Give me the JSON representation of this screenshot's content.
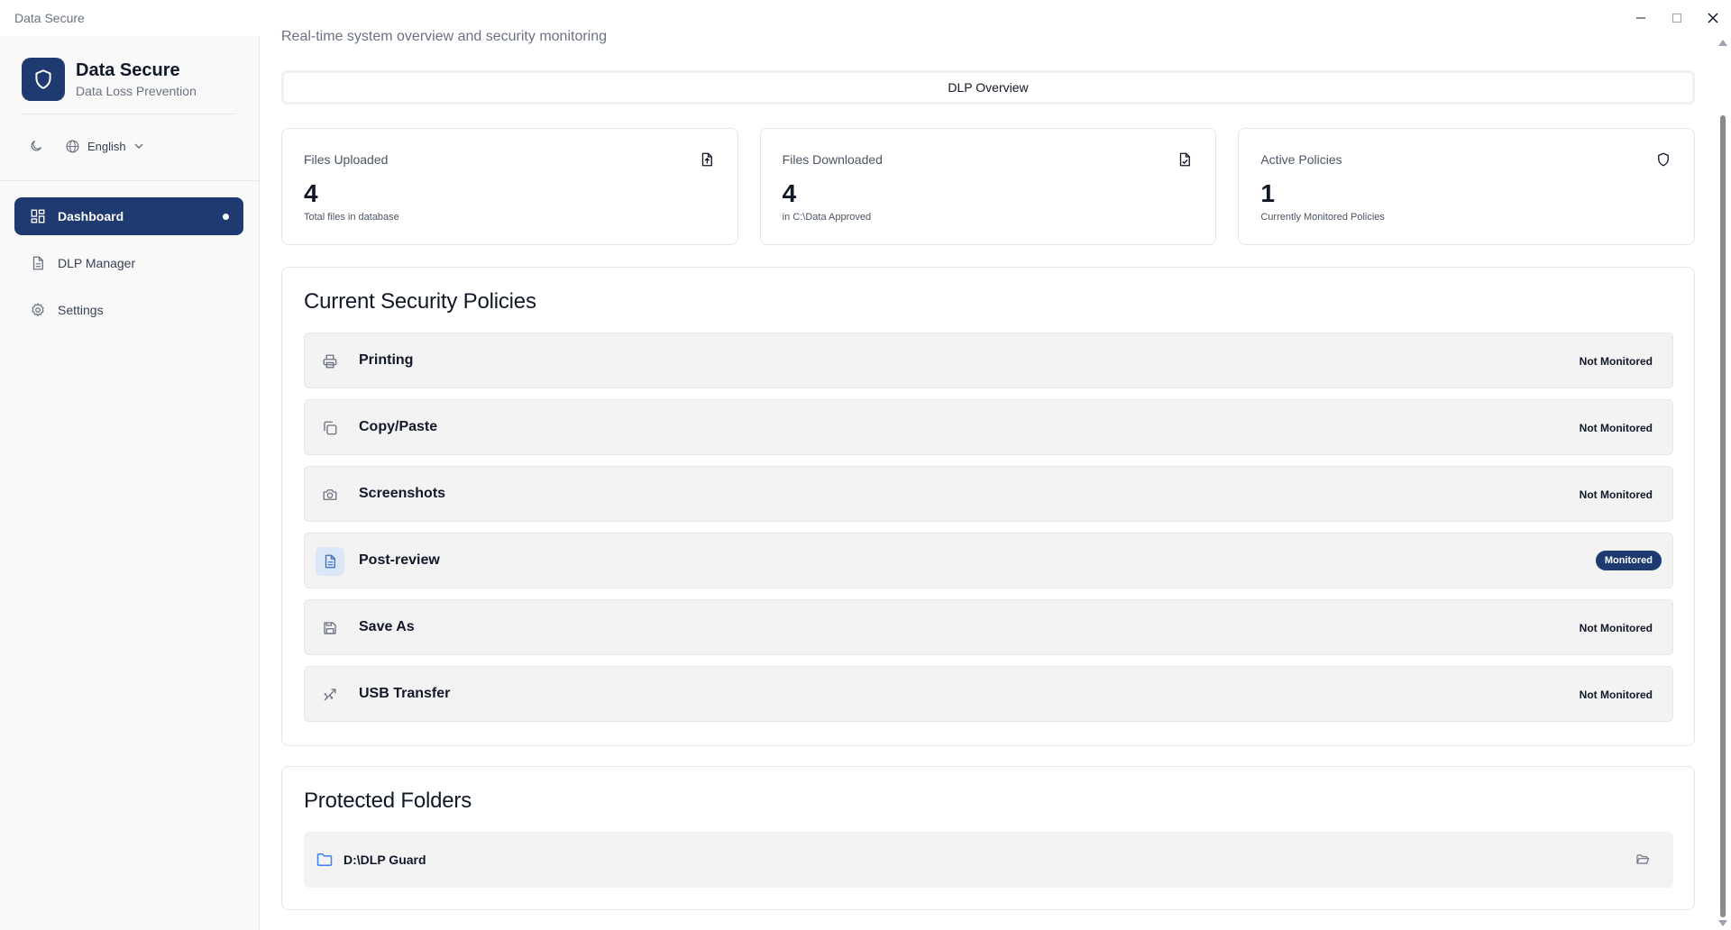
{
  "window": {
    "title": "Data Secure"
  },
  "brand": {
    "title": "Data Secure",
    "subtitle": "Data Loss Prevention",
    "logo_icon": "shield-icon",
    "accent_color": "#1e3a70"
  },
  "tools": {
    "theme_icon": "moon-icon",
    "language_icon": "globe-icon",
    "language": "English"
  },
  "nav": {
    "items": [
      {
        "label": "Dashboard",
        "icon": "dashboard-icon",
        "active": true
      },
      {
        "label": "DLP Manager",
        "icon": "document-icon",
        "active": false
      },
      {
        "label": "Settings",
        "icon": "gear-icon",
        "active": false
      }
    ]
  },
  "page": {
    "subtitle": "Real-time system overview and security monitoring",
    "tab_label": "DLP Overview"
  },
  "stats": [
    {
      "label": "Files Uploaded",
      "value": "4",
      "desc": "Total files in database",
      "icon": "file-upload-icon"
    },
    {
      "label": "Files Downloaded",
      "value": "4",
      "desc": "in C:\\Data Approved",
      "icon": "file-check-icon"
    },
    {
      "label": "Active Policies",
      "value": "1",
      "desc": "Currently Monitored Policies",
      "icon": "shield-icon"
    }
  ],
  "policies": {
    "title": "Current Security Policies",
    "items": [
      {
        "name": "Printing",
        "status": "Not Monitored",
        "icon": "printer-icon",
        "monitored": false
      },
      {
        "name": "Copy/Paste",
        "status": "Not Monitored",
        "icon": "copy-icon",
        "monitored": false
      },
      {
        "name": "Screenshots",
        "status": "Not Monitored",
        "icon": "camera-icon",
        "monitored": false
      },
      {
        "name": "Post-review",
        "status": "Monitored",
        "icon": "document-icon",
        "monitored": true
      },
      {
        "name": "Save As",
        "status": "Not Monitored",
        "icon": "save-icon",
        "monitored": false
      },
      {
        "name": "USB Transfer",
        "status": "Not Monitored",
        "icon": "usb-icon",
        "monitored": false
      }
    ]
  },
  "folders": {
    "title": "Protected Folders",
    "items": [
      {
        "path": "D:\\DLP Guard",
        "icon": "folder-icon"
      }
    ]
  }
}
